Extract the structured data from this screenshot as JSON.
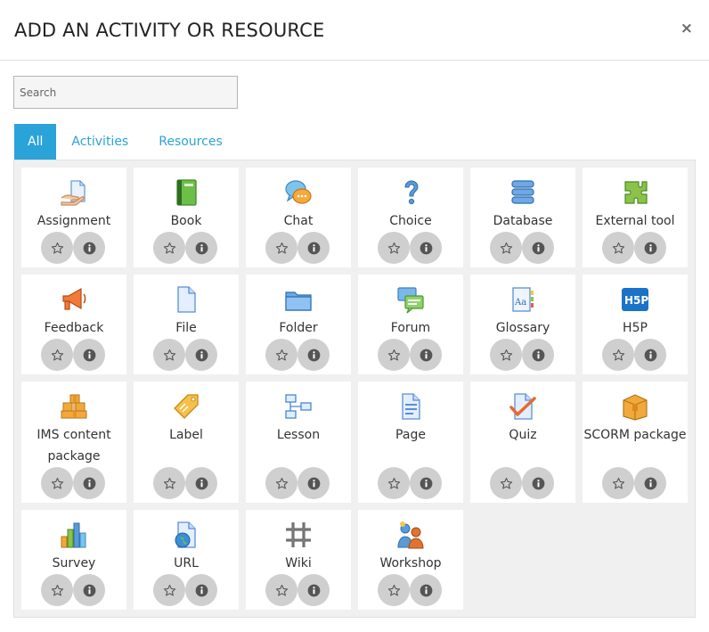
{
  "modal": {
    "title": "ADD AN ACTIVITY OR RESOURCE",
    "close_label": "×"
  },
  "search": {
    "placeholder": "Search"
  },
  "tabs": [
    {
      "label": "All",
      "active": true
    },
    {
      "label": "Activities",
      "active": false
    },
    {
      "label": "Resources",
      "active": false
    }
  ],
  "items": [
    {
      "name": "Assignment",
      "icon": "assignment-icon"
    },
    {
      "name": "Book",
      "icon": "book-icon"
    },
    {
      "name": "Chat",
      "icon": "chat-icon"
    },
    {
      "name": "Choice",
      "icon": "choice-icon"
    },
    {
      "name": "Database",
      "icon": "database-icon"
    },
    {
      "name": "External tool",
      "icon": "external-tool-icon"
    },
    {
      "name": "Feedback",
      "icon": "feedback-icon"
    },
    {
      "name": "File",
      "icon": "file-icon"
    },
    {
      "name": "Folder",
      "icon": "folder-icon"
    },
    {
      "name": "Forum",
      "icon": "forum-icon"
    },
    {
      "name": "Glossary",
      "icon": "glossary-icon"
    },
    {
      "name": "H5P",
      "icon": "h5p-icon"
    },
    {
      "name": "IMS content package",
      "icon": "ims-package-icon"
    },
    {
      "name": "Label",
      "icon": "label-icon"
    },
    {
      "name": "Lesson",
      "icon": "lesson-icon"
    },
    {
      "name": "Page",
      "icon": "page-icon"
    },
    {
      "name": "Quiz",
      "icon": "quiz-icon"
    },
    {
      "name": "SCORM package",
      "icon": "scorm-icon"
    },
    {
      "name": "Survey",
      "icon": "survey-icon"
    },
    {
      "name": "URL",
      "icon": "url-icon"
    },
    {
      "name": "Wiki",
      "icon": "wiki-icon"
    },
    {
      "name": "Workshop",
      "icon": "workshop-icon"
    }
  ],
  "colors": {
    "accent": "#2aa3d8",
    "tile_background": "#ffffff",
    "grid_background": "#f0f0f0",
    "action_button": "#cfcfcf"
  }
}
